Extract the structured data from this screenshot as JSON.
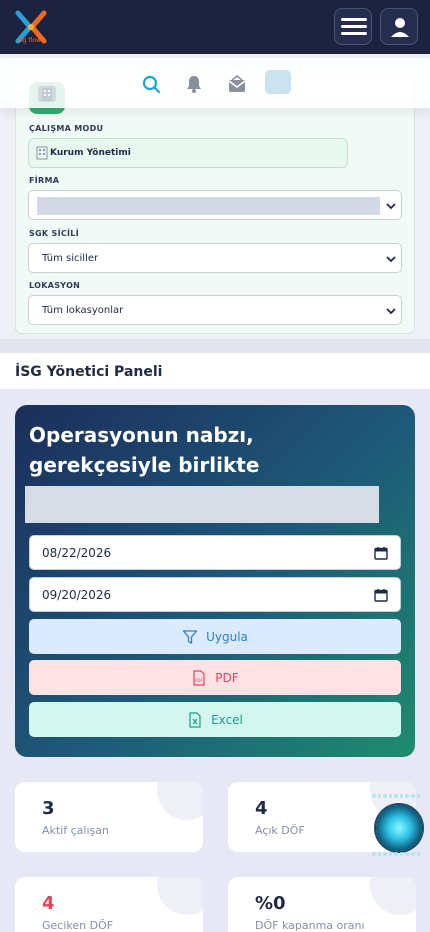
{
  "app": {
    "logo_text": "isg flow"
  },
  "filter": {
    "mode_label": "ÇALIŞMA MODU",
    "mode_value": "Kurum Yönetimi",
    "firm_label": "FİRMA",
    "sgk_label": "SGK SİCİLİ",
    "sgk_value": "Tüm siciller",
    "location_label": "LOKASYON",
    "location_value": "Tüm lokasyonlar"
  },
  "section": {
    "title": "İSG Yönetici Paneli"
  },
  "hero": {
    "title": "Operasyonun nabzı, gerekçesiyle birlikte",
    "start_date": "08/22/2026",
    "end_date": "09/20/2026",
    "apply_label": "Uygula",
    "pdf_label": "PDF",
    "excel_label": "Excel"
  },
  "stats": [
    {
      "value": "3",
      "label": "Aktif çalışan",
      "color": "#1f2a44"
    },
    {
      "value": "4",
      "label": "Açık DÖF",
      "color": "#1f2a44"
    },
    {
      "value": "4",
      "label": "Geciken DÖF",
      "color": "#e0455a"
    },
    {
      "value": "%0",
      "label": "DÖF kapanma oranı",
      "color": "#1f2a44"
    }
  ],
  "colors": {
    "topbar": "#1c2340",
    "accent_green": "#2fae6c",
    "apply_bg": "#dcebfb",
    "pdf_bg": "#fde1e4",
    "excel_bg": "#d3f6ef"
  },
  "icons": [
    "logo-icon",
    "menu-icon",
    "user-icon",
    "search-icon",
    "bell-icon",
    "envelope-icon",
    "building-icon",
    "chevron-down-icon",
    "calendar-icon",
    "filter-icon",
    "pdf-icon",
    "excel-icon",
    "assistant-orb-icon"
  ]
}
